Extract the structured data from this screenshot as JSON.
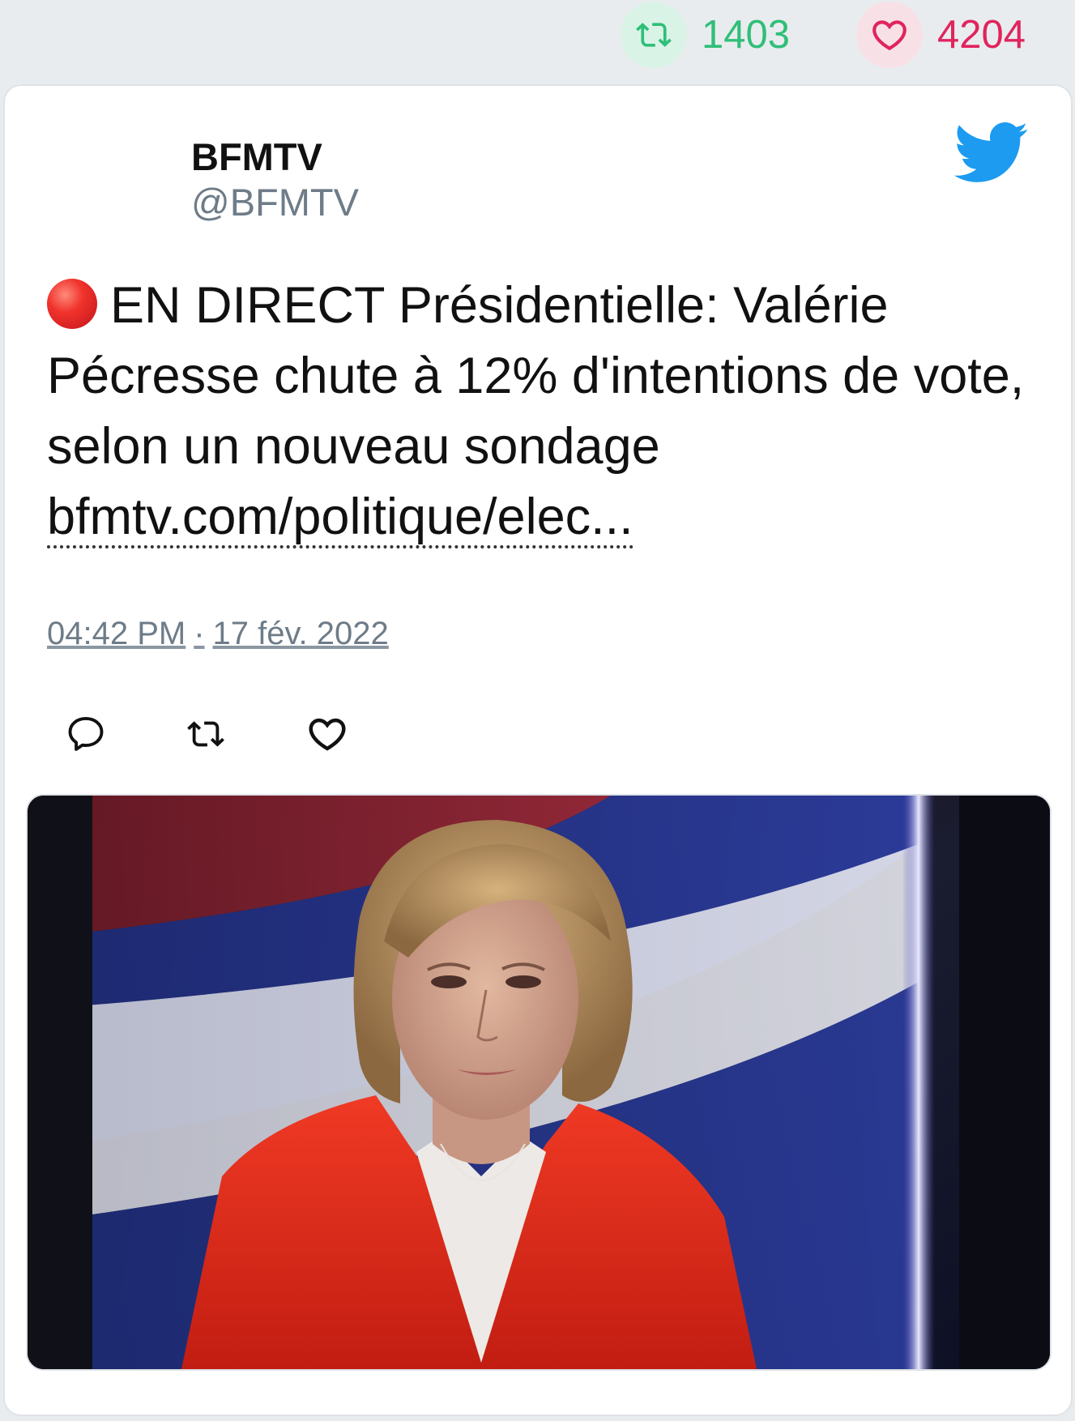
{
  "stats": {
    "retweets": "1403",
    "likes": "4204",
    "retweet_icon": "retweet-icon",
    "like_icon": "heart-icon"
  },
  "tweet": {
    "author_name": "BFMTV",
    "author_handle": "@BFMTV",
    "text": "EN DIRECT Présidentielle: Valérie Pécresse chute à 12% d'intentions de vote, selon un nouveau sondage",
    "link": "bfmtv.com/politique/elec...",
    "time": "04:42 PM",
    "separator": "·",
    "date": "17 fév. 2022",
    "actions": [
      "reply-icon",
      "retweet-icon",
      "heart-icon"
    ]
  },
  "colors": {
    "retweet_green": "#2fbf78",
    "like_red": "#e0245e",
    "twitter_blue": "#1d9bf0",
    "muted_text": "#6e7c88"
  }
}
